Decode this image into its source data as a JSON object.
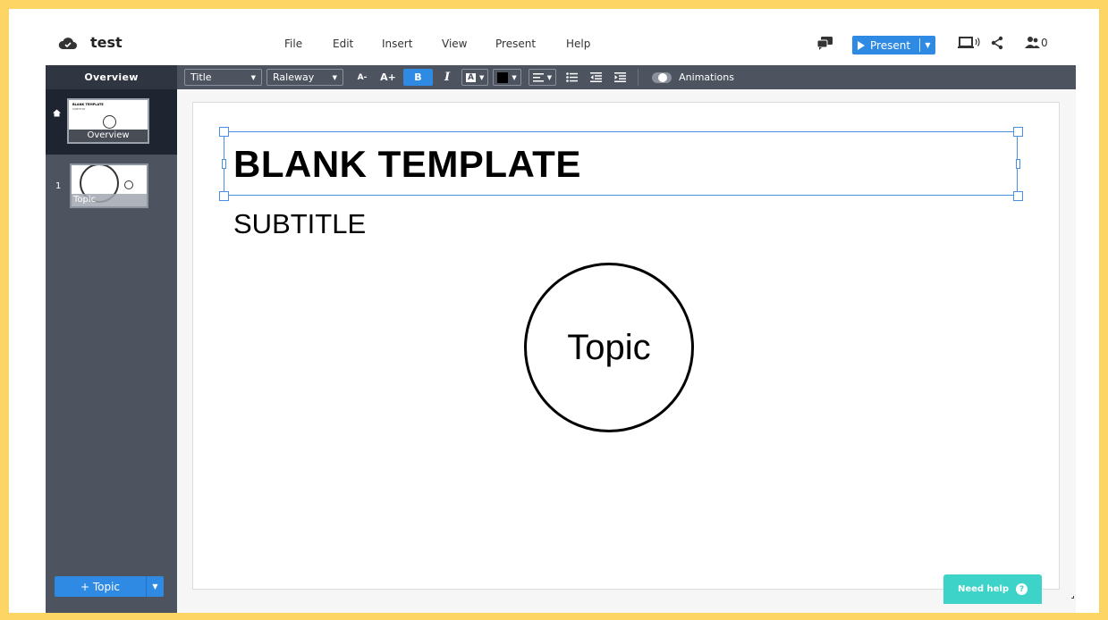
{
  "app": {
    "doc_title": "test"
  },
  "menu": [
    "File",
    "Edit",
    "Insert",
    "View",
    "Present",
    "Help"
  ],
  "header": {
    "present_label": "Present",
    "collaborators_count": "0",
    "accent_color": "#2f8ae3"
  },
  "sidebar": {
    "heading": "Overview",
    "overview_thumb_label": "Overview",
    "overview_mini_title": "BLANK TEMPLATE",
    "overview_mini_subtitle": "SUBTITLE",
    "slides": [
      {
        "number": "1",
        "label": "Topic"
      }
    ],
    "add_topic_label": "+ Topic"
  },
  "toolbar": {
    "style_select": "Title",
    "font_select": "Raleway",
    "decrease_font": "A-",
    "increase_font": "A+",
    "bold": "B",
    "italic": "I",
    "highlight": "A",
    "animations_label": "Animations"
  },
  "slide": {
    "title": "BLANK TEMPLATE",
    "subtitle": "SUBTITLE",
    "topic": "Topic"
  },
  "help": {
    "label": "Need help",
    "icon_text": "?"
  },
  "colors": {
    "help": "#3dd3c8",
    "sidebar": "#4d5460",
    "frame": "#fdd565"
  }
}
